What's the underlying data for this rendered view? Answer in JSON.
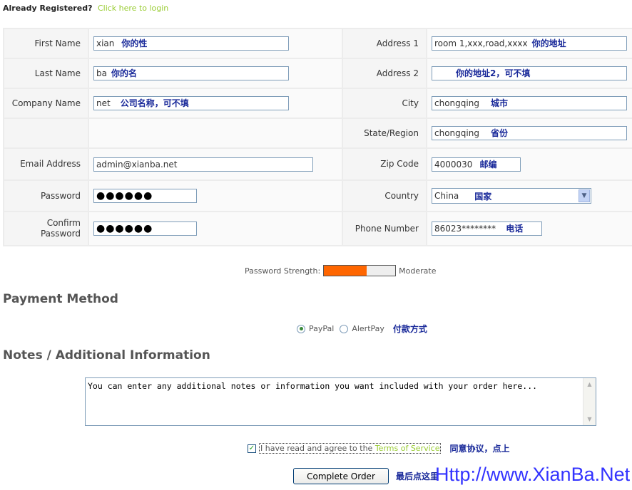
{
  "header": {
    "registered_text": "Already Registered?",
    "login_link": "Click here to login"
  },
  "form": {
    "first_name": {
      "label": "First Name",
      "value": "xian",
      "note": "你的性"
    },
    "last_name": {
      "label": "Last Name",
      "value": "ba",
      "note": "你的名"
    },
    "company": {
      "label": "Company Name",
      "value": "net",
      "note": "公司名称，可不填"
    },
    "email": {
      "label": "Email Address",
      "value": "admin@xianba.net"
    },
    "password": {
      "label": "Password",
      "value": "●●●●●●"
    },
    "confirm": {
      "label_line1": "Confirm",
      "label_line2": "Password",
      "value": "●●●●●●"
    },
    "address1": {
      "label": "Address 1",
      "value": "room 1,xxx,road,xxxx",
      "note": "你的地址"
    },
    "address2": {
      "label": "Address 2",
      "value": "",
      "note": "你的地址2，可不填"
    },
    "city": {
      "label": "City",
      "value": "chongqing",
      "note": "城市"
    },
    "state": {
      "label": "State/Region",
      "value": "chongqing",
      "note": "省份"
    },
    "zip": {
      "label": "Zip Code",
      "value": "4000030",
      "note": "邮编"
    },
    "country": {
      "label": "Country",
      "value": "China",
      "note": "国家"
    },
    "phone": {
      "label": "Phone Number",
      "value": "86023********",
      "note": "电话"
    }
  },
  "strength": {
    "label": "Password Strength:",
    "level": "Moderate",
    "fill_percent": 60,
    "color": "#ff6600"
  },
  "payment": {
    "title": "Payment Method",
    "options": [
      "PayPal",
      "AlertPay"
    ],
    "selected": "PayPal",
    "note": "付款方式"
  },
  "notes": {
    "title": "Notes / Additional Information",
    "text": "You can enter any additional notes or information you want included with your order here..."
  },
  "agree": {
    "text": "I have read and agree to the",
    "link": "Terms of Service",
    "checked": true,
    "note": "同意协议，点上"
  },
  "submit": {
    "label": "Complete Order",
    "note": "最后点这里"
  },
  "watermark": "Http://www.XianBa.Net"
}
